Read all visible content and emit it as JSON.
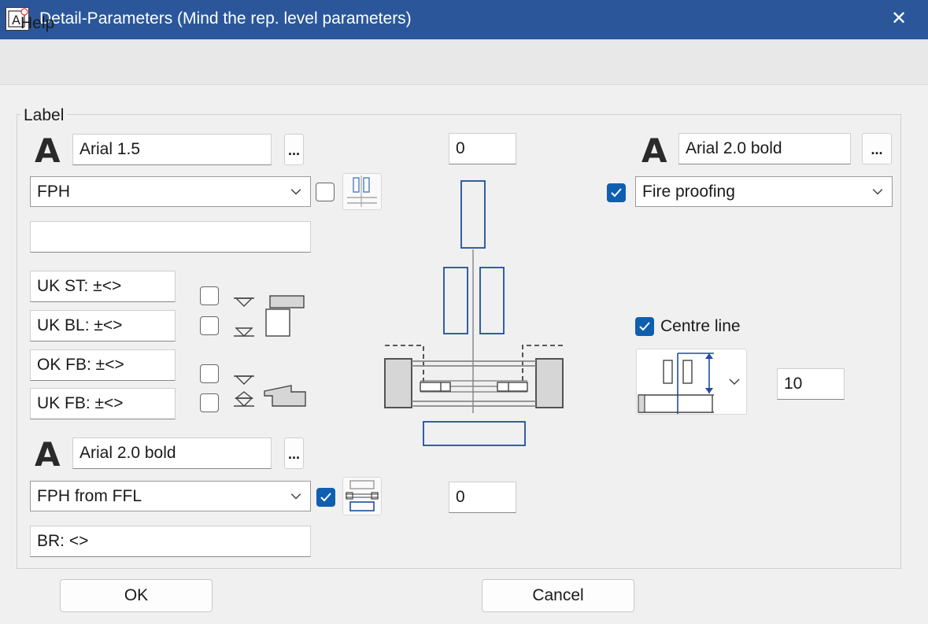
{
  "window": {
    "title": "Detail-Parameters (Mind the rep. level parameters)",
    "close_glyph": "✕"
  },
  "menu": {
    "help": "Help"
  },
  "group": {
    "label": "Label"
  },
  "left_top": {
    "font": "Arial 1.5",
    "browse": "...",
    "combo_value": "FPH",
    "checkbox_checked": false,
    "text_field": ""
  },
  "level_fields": [
    {
      "value": "UK ST: ±<>"
    },
    {
      "value": "UK BL: ±<>"
    },
    {
      "value": "OK FB: ±<>"
    },
    {
      "value": "UK FB: ±<>"
    }
  ],
  "level_checks": [
    false,
    false,
    false,
    false
  ],
  "left_bottom": {
    "font": "Arial 2.0 bold",
    "browse": "...",
    "combo_value": "FPH from FFL",
    "checkbox_checked": true,
    "text_field": "BR: <>"
  },
  "center": {
    "top_value": "0",
    "bottom_value": "0"
  },
  "right": {
    "font": "Arial 2.0 bold",
    "browse": "...",
    "fire_checked": true,
    "fire_value": "Fire proofing",
    "centre_line_checked": true,
    "centre_line_label": "Centre line",
    "distance_value": "10"
  },
  "buttons": {
    "ok": "OK",
    "cancel": "Cancel"
  },
  "icons": {
    "font_glyph": "A",
    "app": "app-icon",
    "check": "check-icon",
    "chevron": "chevron-down-icon"
  },
  "colors": {
    "titlebar": "#2b579a",
    "accent": "#0f5eb0",
    "diagram_blue": "#1f4e9c"
  }
}
